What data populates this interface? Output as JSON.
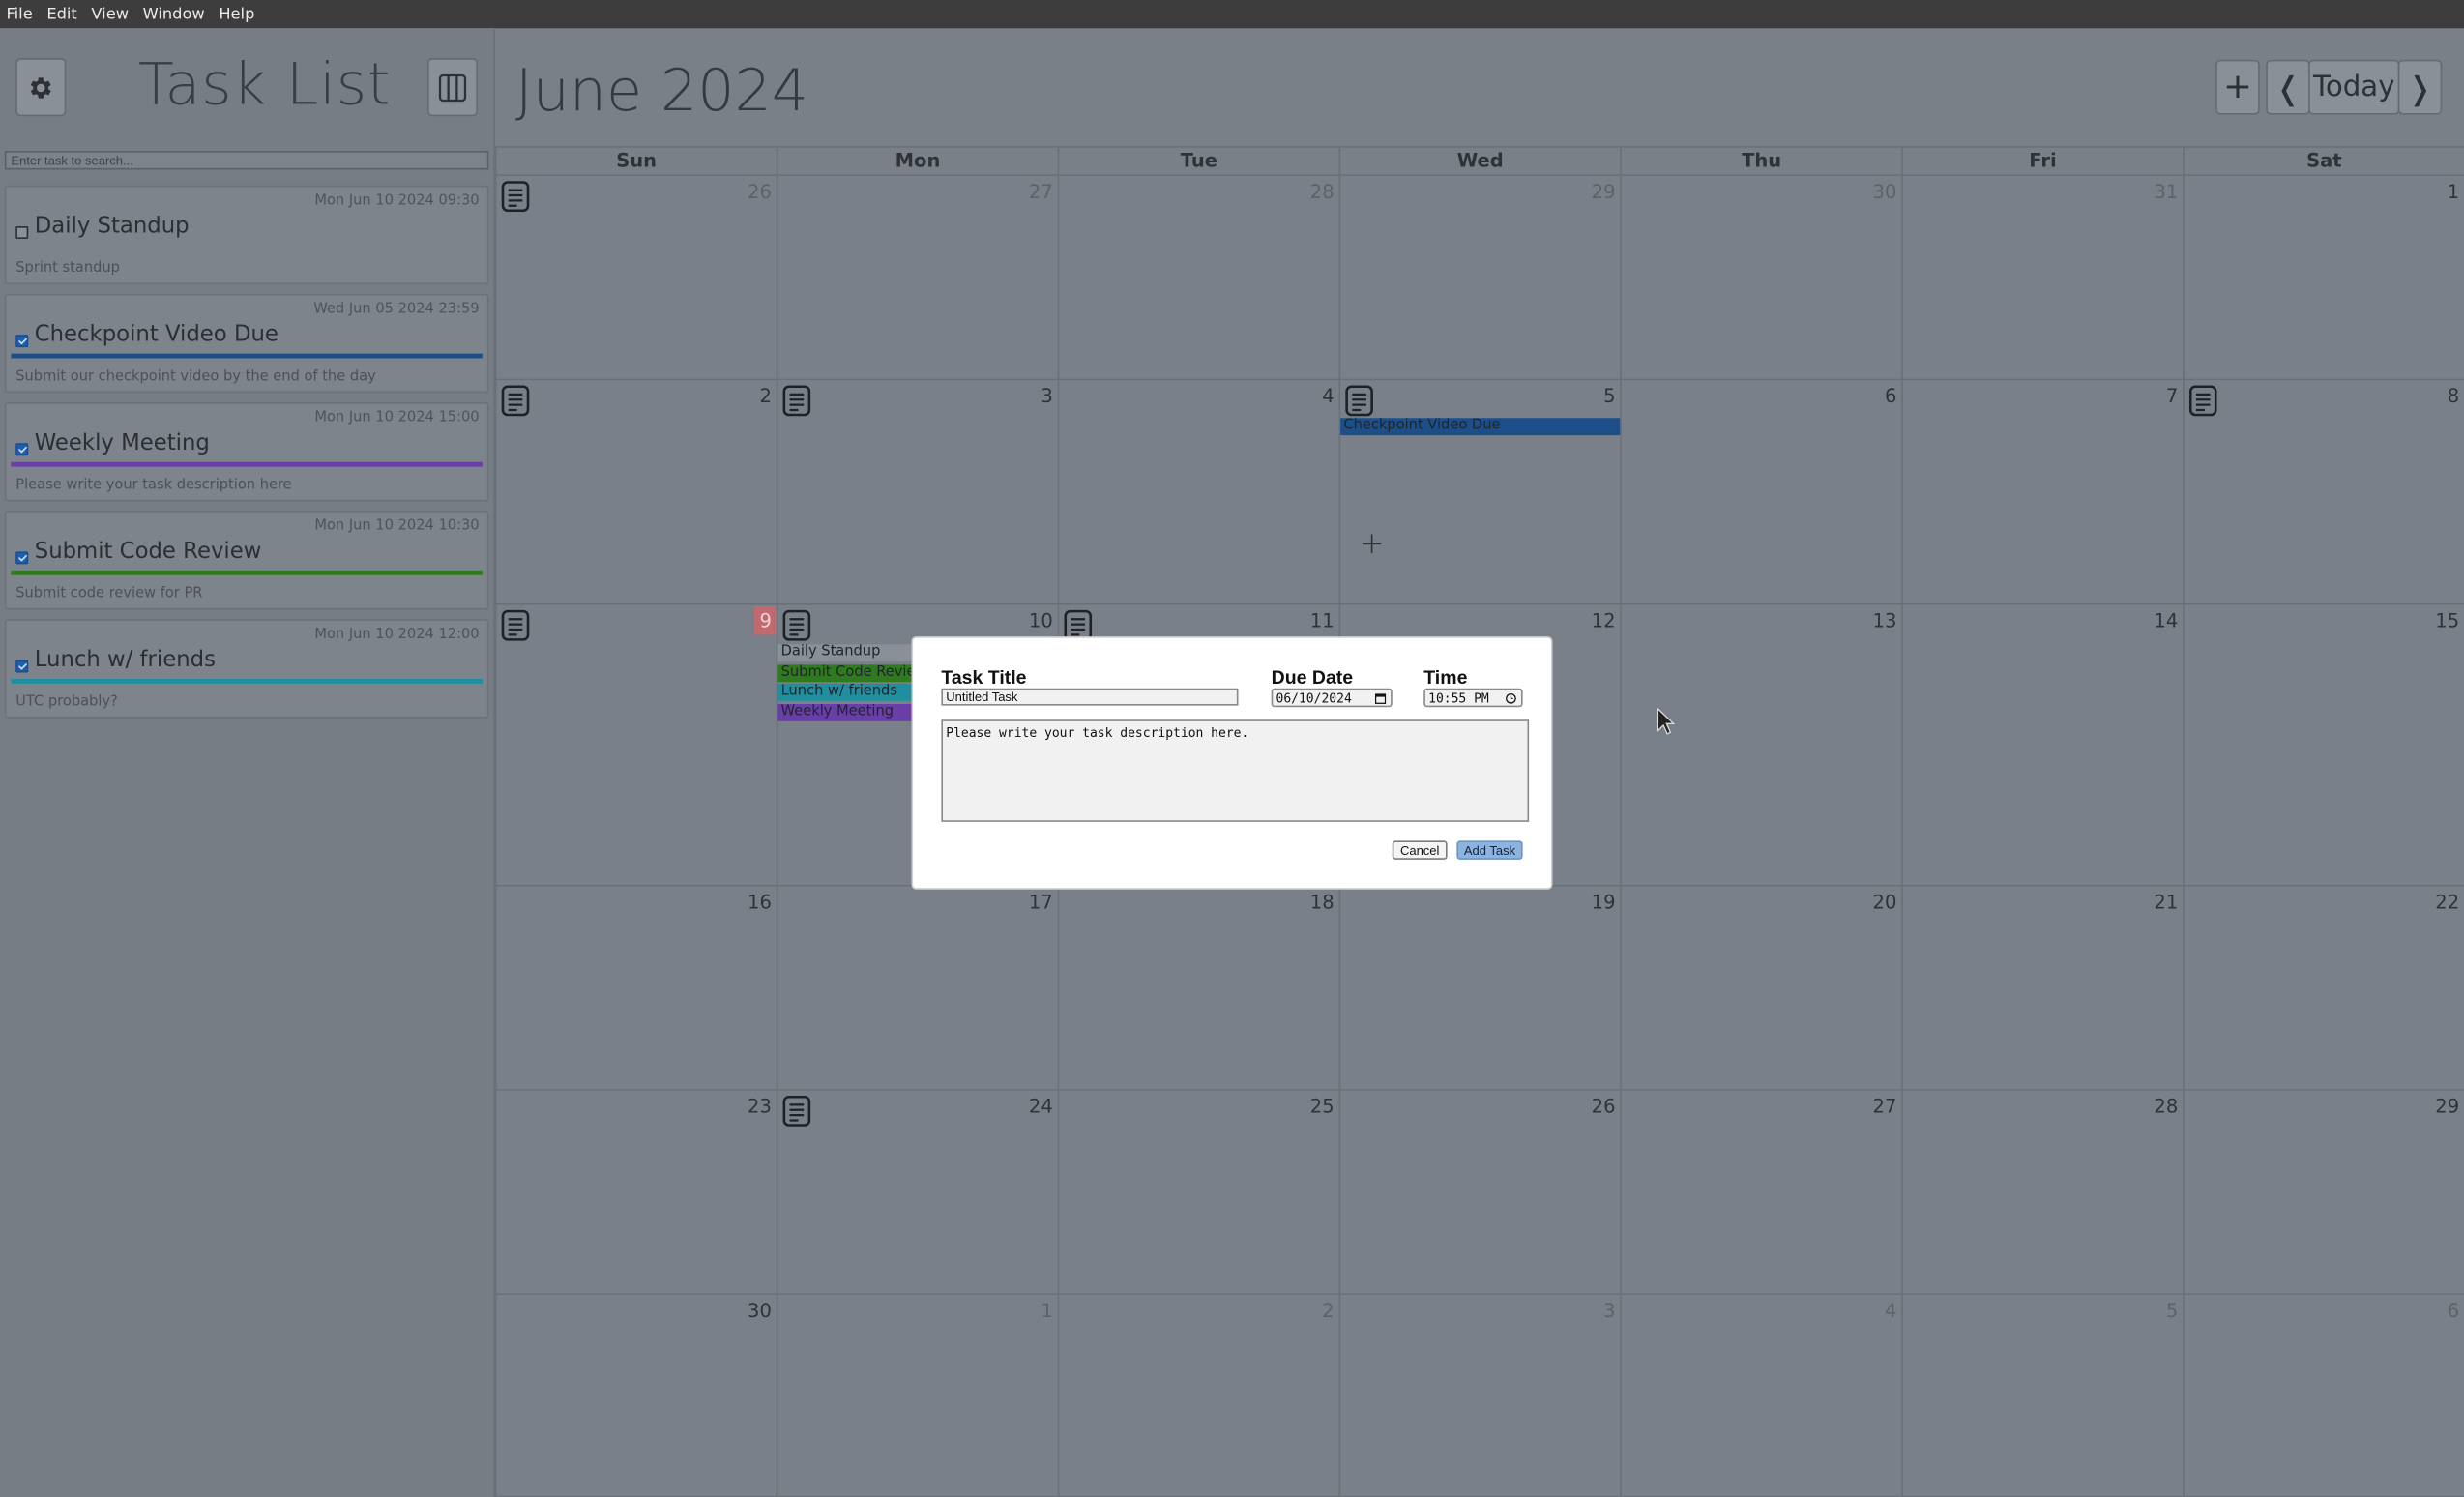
{
  "menu": [
    "File",
    "Edit",
    "View",
    "Window",
    "Help"
  ],
  "sidebar": {
    "title": "Task List",
    "search_placeholder": "Enter task to search...",
    "tasks": [
      {
        "date": "Mon Jun 10 2024 09:30",
        "title": "Daily Standup",
        "desc": "Sprint standup",
        "checked": false,
        "color": ""
      },
      {
        "date": "Wed Jun 05 2024 23:59",
        "title": "Checkpoint Video Due",
        "desc": "Submit our checkpoint video by the end of the day",
        "checked": true,
        "color": "#1c4f8a"
      },
      {
        "date": "Mon Jun 10 2024 15:00",
        "title": "Weekly Meeting",
        "desc": "Please write your task description here",
        "checked": true,
        "color": "#6a3ea8"
      },
      {
        "date": "Mon Jun 10 2024 10:30",
        "title": "Submit Code Review",
        "desc": "Submit code review for PR",
        "checked": true,
        "color": "#2f7a1e"
      },
      {
        "date": "Mon Jun 10 2024 12:00",
        "title": "Lunch w/ friends",
        "desc": "UTC probably?",
        "checked": true,
        "color": "#1f8fa0"
      }
    ]
  },
  "calendar": {
    "month_title": "June 2024",
    "add_label": "+",
    "prev_label": "❬",
    "today_label": "Today",
    "next_label": "❭",
    "days_of_week": [
      "Sun",
      "Mon",
      "Tue",
      "Wed",
      "Thu",
      "Fri",
      "Sat"
    ],
    "weeks": [
      [
        {
          "n": "26",
          "o": true,
          "note": true
        },
        {
          "n": "27",
          "o": true
        },
        {
          "n": "28",
          "o": true
        },
        {
          "n": "29",
          "o": true
        },
        {
          "n": "30",
          "o": true
        },
        {
          "n": "31",
          "o": true
        },
        {
          "n": "1"
        }
      ],
      [
        {
          "n": "2",
          "note": true
        },
        {
          "n": "3",
          "note": true
        },
        {
          "n": "4"
        },
        {
          "n": "5",
          "note": true,
          "events": [
            {
              "t": "Checkpoint Video Due",
              "c": "#1c4f8a"
            }
          ]
        },
        {
          "n": "6"
        },
        {
          "n": "7"
        },
        {
          "n": "8",
          "note": true
        }
      ],
      [
        {
          "n": "9",
          "note": true,
          "today": true
        },
        {
          "n": "10",
          "note": true,
          "events": [
            {
              "t": "Daily Standup",
              "c": "#8a9098"
            },
            {
              "t": "Submit Code Review",
              "c": "#2f7a1e"
            },
            {
              "t": "Lunch w/ friends",
              "c": "#1f8fa0"
            },
            {
              "t": "Weekly Meeting",
              "c": "#6a3ea8"
            }
          ]
        },
        {
          "n": "11",
          "note": true
        },
        {
          "n": "12"
        },
        {
          "n": "13"
        },
        {
          "n": "14"
        },
        {
          "n": "15"
        }
      ],
      [
        {
          "n": "16"
        },
        {
          "n": "17"
        },
        {
          "n": "18"
        },
        {
          "n": "19"
        },
        {
          "n": "20"
        },
        {
          "n": "21"
        },
        {
          "n": "22"
        }
      ],
      [
        {
          "n": "23"
        },
        {
          "n": "24",
          "note": true
        },
        {
          "n": "25"
        },
        {
          "n": "26"
        },
        {
          "n": "27"
        },
        {
          "n": "28"
        },
        {
          "n": "29"
        }
      ],
      [
        {
          "n": "30"
        },
        {
          "n": "1",
          "o": true
        },
        {
          "n": "2",
          "o": true
        },
        {
          "n": "3",
          "o": true
        },
        {
          "n": "4",
          "o": true
        },
        {
          "n": "5",
          "o": true
        },
        {
          "n": "6",
          "o": true
        }
      ]
    ]
  },
  "modal": {
    "title_label": "Task Title",
    "title_value": "Untitled Task",
    "date_label": "Due Date",
    "date_value": "06/10/2024",
    "time_label": "Time",
    "time_value": "10:55 PM",
    "description": "Please write your task description here.",
    "cancel_label": "Cancel",
    "add_label": "Add Task"
  }
}
